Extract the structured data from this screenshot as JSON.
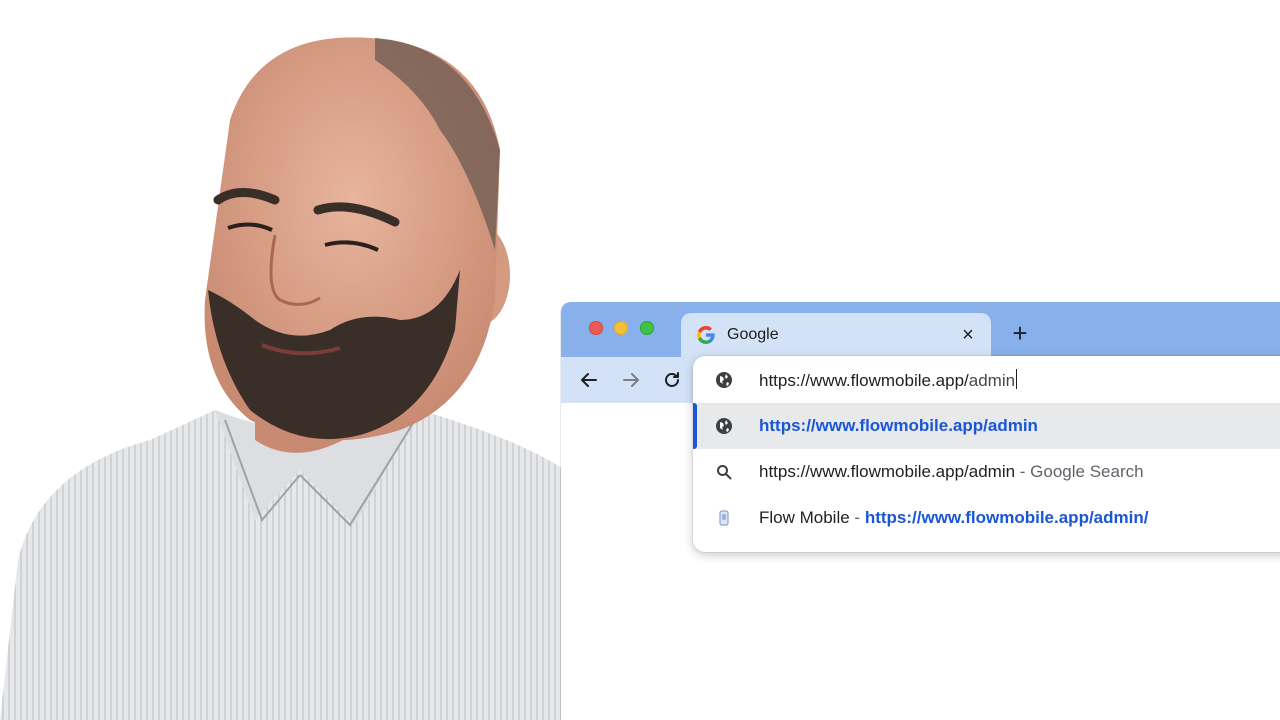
{
  "window": {
    "tab": {
      "title": "Google",
      "favicon": "google-g-icon"
    },
    "controls": {
      "close_tab": "×",
      "new_tab": "+"
    },
    "toolbar": {
      "back": "back-arrow-icon",
      "forward": "forward-arrow-icon",
      "reload": "reload-icon"
    }
  },
  "omnibox": {
    "input_prefix": "https://www.flowmobile.app/",
    "input_suffix": "admin",
    "suggestions": [
      {
        "icon": "globe-icon",
        "text": "https://www.flowmobile.app/admin",
        "selected": true
      },
      {
        "icon": "search-icon",
        "text": "https://www.flowmobile.app/admin",
        "suffix": " - Google Search"
      },
      {
        "icon": "app-favicon-icon",
        "site": "Flow Mobile",
        "separator": " - ",
        "link": "https://www.flowmobile.app/admin/"
      }
    ]
  },
  "colors": {
    "tabstrip": "#88b0ea",
    "active_tab": "#d4e2f8",
    "link_blue": "#1a56d6",
    "selected_row": "#e8e9ea"
  }
}
